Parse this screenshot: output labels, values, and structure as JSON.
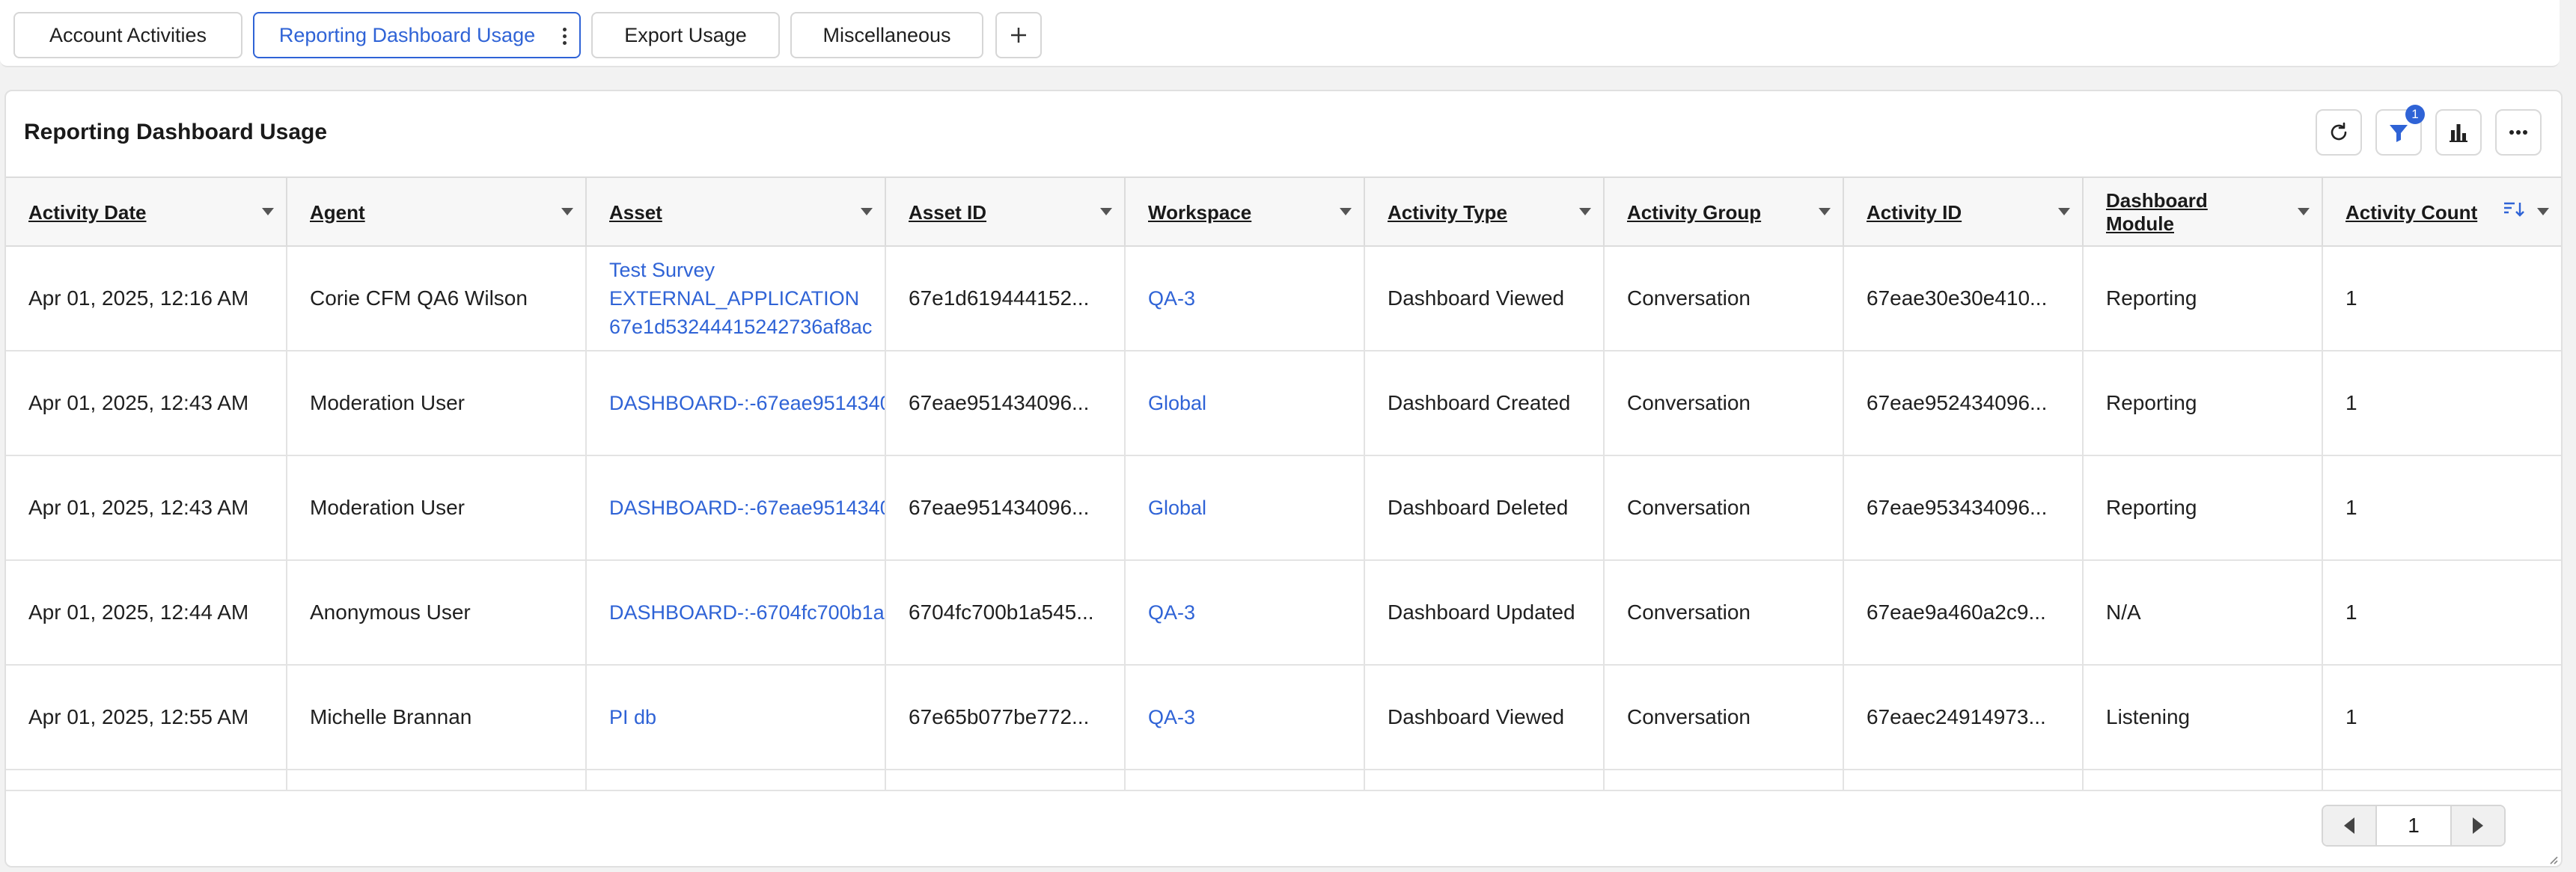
{
  "tabs": [
    {
      "label": "Account Activities",
      "active": false
    },
    {
      "label": "Reporting Dashboard Usage",
      "active": true
    },
    {
      "label": "Export Usage",
      "active": false
    },
    {
      "label": "Miscellaneous",
      "active": false
    }
  ],
  "panel": {
    "title": "Reporting Dashboard Usage",
    "filter_badge": "1"
  },
  "columns": [
    {
      "label": "Activity Date"
    },
    {
      "label": "Agent"
    },
    {
      "label": "Asset"
    },
    {
      "label": "Asset ID"
    },
    {
      "label": "Workspace"
    },
    {
      "label": "Activity Type"
    },
    {
      "label": "Activity Group"
    },
    {
      "label": "Activity ID"
    },
    {
      "label": "Dashboard Module"
    },
    {
      "label": "Activity Count"
    }
  ],
  "rows": [
    {
      "activity_date": "Apr 01, 2025, 12:16 AM",
      "agent": "Corie CFM QA6 Wilson",
      "asset_lines": [
        "Test Survey",
        "EXTERNAL_APPLICATION",
        "67e1d53244415242736af8ac"
      ],
      "asset_id": "67e1d619444152...",
      "workspace": "QA-3",
      "activity_type": "Dashboard Viewed",
      "activity_group": "Conversation",
      "activity_id": "67eae30e30e410...",
      "dashboard_module": "Reporting",
      "activity_count": "1"
    },
    {
      "activity_date": "Apr 01, 2025, 12:43 AM",
      "agent": "Moderation User",
      "asset_lines": [
        "DASHBOARD-:-67eae9514340"
      ],
      "asset_id": "67eae951434096...",
      "workspace": "Global",
      "activity_type": "Dashboard Created",
      "activity_group": "Conversation",
      "activity_id": "67eae952434096...",
      "dashboard_module": "Reporting",
      "activity_count": "1"
    },
    {
      "activity_date": "Apr 01, 2025, 12:43 AM",
      "agent": "Moderation User",
      "asset_lines": [
        "DASHBOARD-:-67eae9514340"
      ],
      "asset_id": "67eae951434096...",
      "workspace": "Global",
      "activity_type": "Dashboard Deleted",
      "activity_group": "Conversation",
      "activity_id": "67eae953434096...",
      "dashboard_module": "Reporting",
      "activity_count": "1"
    },
    {
      "activity_date": "Apr 01, 2025, 12:44 AM",
      "agent": "Anonymous User",
      "asset_lines": [
        "DASHBOARD-:-6704fc700b1a"
      ],
      "asset_id": "6704fc700b1a545...",
      "workspace": "QA-3",
      "activity_type": "Dashboard Updated",
      "activity_group": "Conversation",
      "activity_id": "67eae9a460a2c9...",
      "dashboard_module": "N/A",
      "activity_count": "1"
    },
    {
      "activity_date": "Apr 01, 2025, 12:55 AM",
      "agent": "Michelle Brannan",
      "asset_lines": [
        "PI db"
      ],
      "asset_id": "67e65b077be772...",
      "workspace": "QA-3",
      "activity_type": "Dashboard Viewed",
      "activity_group": "Conversation",
      "activity_id": "67eaec24914973...",
      "dashboard_module": "Listening",
      "activity_count": "1"
    }
  ],
  "pagination": {
    "page": "1"
  },
  "icons": {
    "refresh": "refresh-icon",
    "filter": "filter-icon",
    "chart": "bar-chart-icon",
    "more": "more-horizontal-icon",
    "add": "plus-icon",
    "sort": "sort-descending-icon"
  },
  "colors": {
    "accent": "#2f63d6",
    "link": "#2f63d6"
  }
}
